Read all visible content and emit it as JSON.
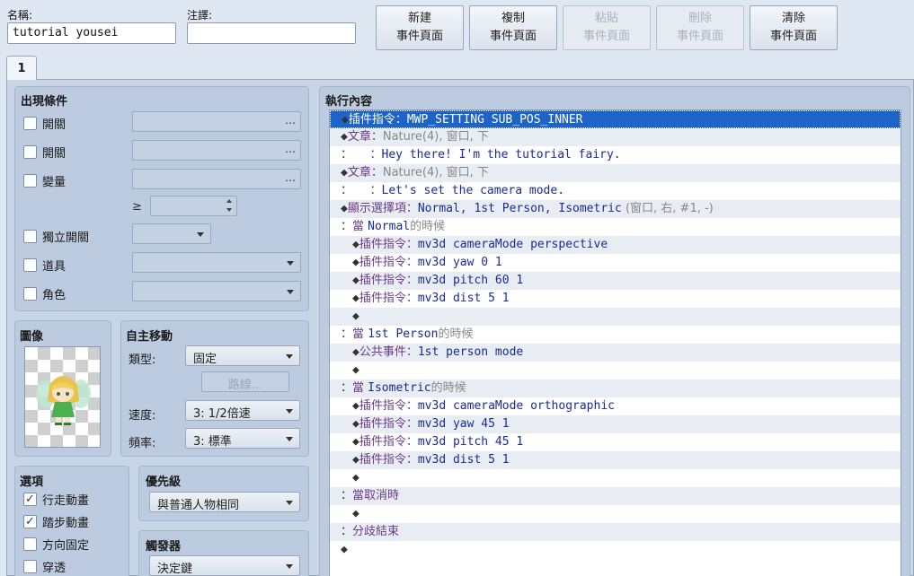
{
  "header": {
    "name_label": "名稱:",
    "name_value": "tutorial yousei",
    "note_label": "注譯:",
    "note_value": "",
    "buttons": [
      {
        "line1": "新建",
        "line2": "事件頁面",
        "enabled": true
      },
      {
        "line1": "複制",
        "line2": "事件頁面",
        "enabled": true
      },
      {
        "line1": "粘貼",
        "line2": "事件頁面",
        "enabled": false
      },
      {
        "line1": "刪除",
        "line2": "事件頁面",
        "enabled": false
      },
      {
        "line1": "清除",
        "line2": "事件頁面",
        "enabled": true
      }
    ]
  },
  "tabs": [
    {
      "label": "1"
    }
  ],
  "conditions": {
    "title": "出現條件",
    "switch1": "開關",
    "switch2": "開關",
    "variable": "變量",
    "ge_symbol": "≥",
    "self_switch": "獨立開關",
    "item": "道具",
    "actor": "角色",
    "dots": "…"
  },
  "image": {
    "title": "圖像"
  },
  "autonomous": {
    "title": "自主移動",
    "type_label": "類型:",
    "type_value": "固定",
    "route_button": "路線...",
    "speed_label": "速度:",
    "speed_value": "3: 1/2倍速",
    "freq_label": "頻率:",
    "freq_value": "3: 標準"
  },
  "options": {
    "title": "選項",
    "items": [
      {
        "label": "行走動畫",
        "checked": true,
        "mark": "✓"
      },
      {
        "label": "踏步動畫",
        "checked": true,
        "mark": "✓"
      },
      {
        "label": "方向固定",
        "checked": false,
        "mark": ""
      },
      {
        "label": "穿透",
        "checked": false,
        "mark": ""
      }
    ]
  },
  "priority": {
    "title": "優先級",
    "value": "與普通人物相同"
  },
  "trigger": {
    "title": "觸發器",
    "value": "決定鍵"
  },
  "contents": {
    "title": "執行內容",
    "rows": [
      {
        "pre": "◆",
        "k": "插件指令：",
        "v": "MWP_SETTING SUB_POS_INNER",
        "g": ""
      },
      {
        "pre": "◆",
        "k": "文章：",
        "v": "",
        "g": "Nature(4), 窗口, 下"
      },
      {
        "pre": "：",
        "k": "　　：",
        "v": "Hey there! I'm the tutorial fairy.",
        "g": ""
      },
      {
        "pre": "◆",
        "k": "文章：",
        "v": "",
        "g": "Nature(4), 窗口, 下"
      },
      {
        "pre": "：",
        "k": "　　：",
        "v": "Let's set the camera mode.",
        "g": ""
      },
      {
        "pre": "◆",
        "k": "顯示選擇項：",
        "v": "Normal, 1st Person, Isometric",
        "g": " (窗口, 右, #1, -)"
      },
      {
        "pre": "：",
        "k": "當 ",
        "v": "Normal",
        "g": "的時候"
      },
      {
        "pre": "　◆",
        "k": "插件指令：",
        "v": "mv3d cameraMode perspective",
        "g": ""
      },
      {
        "pre": "　◆",
        "k": "插件指令：",
        "v": "mv3d yaw 0 1",
        "g": ""
      },
      {
        "pre": "　◆",
        "k": "插件指令：",
        "v": "mv3d pitch 60 1",
        "g": ""
      },
      {
        "pre": "　◆",
        "k": "插件指令：",
        "v": "mv3d dist 5 1",
        "g": ""
      },
      {
        "pre": "　◆",
        "k": "",
        "v": "",
        "g": ""
      },
      {
        "pre": "：",
        "k": "當 ",
        "v": "1st Person",
        "g": "的時候"
      },
      {
        "pre": "　◆",
        "k": "公共事件：",
        "v": "1st person mode",
        "g": ""
      },
      {
        "pre": "　◆",
        "k": "",
        "v": "",
        "g": ""
      },
      {
        "pre": "：",
        "k": "當 ",
        "v": "Isometric",
        "g": "的時候"
      },
      {
        "pre": "　◆",
        "k": "插件指令：",
        "v": "mv3d cameraMode orthographic",
        "g": ""
      },
      {
        "pre": "　◆",
        "k": "插件指令：",
        "v": "mv3d yaw 45 1",
        "g": ""
      },
      {
        "pre": "　◆",
        "k": "插件指令：",
        "v": "mv3d pitch 45 1",
        "g": ""
      },
      {
        "pre": "　◆",
        "k": "插件指令：",
        "v": "mv3d dist 5 1",
        "g": ""
      },
      {
        "pre": "　◆",
        "k": "",
        "v": "",
        "g": ""
      },
      {
        "pre": "：",
        "k": "當取消時",
        "v": "",
        "g": ""
      },
      {
        "pre": "　◆",
        "k": "",
        "v": "",
        "g": ""
      },
      {
        "pre": "：",
        "k": "分歧結束",
        "v": "",
        "g": ""
      },
      {
        "pre": "◆",
        "k": "",
        "v": "",
        "g": ""
      }
    ]
  }
}
